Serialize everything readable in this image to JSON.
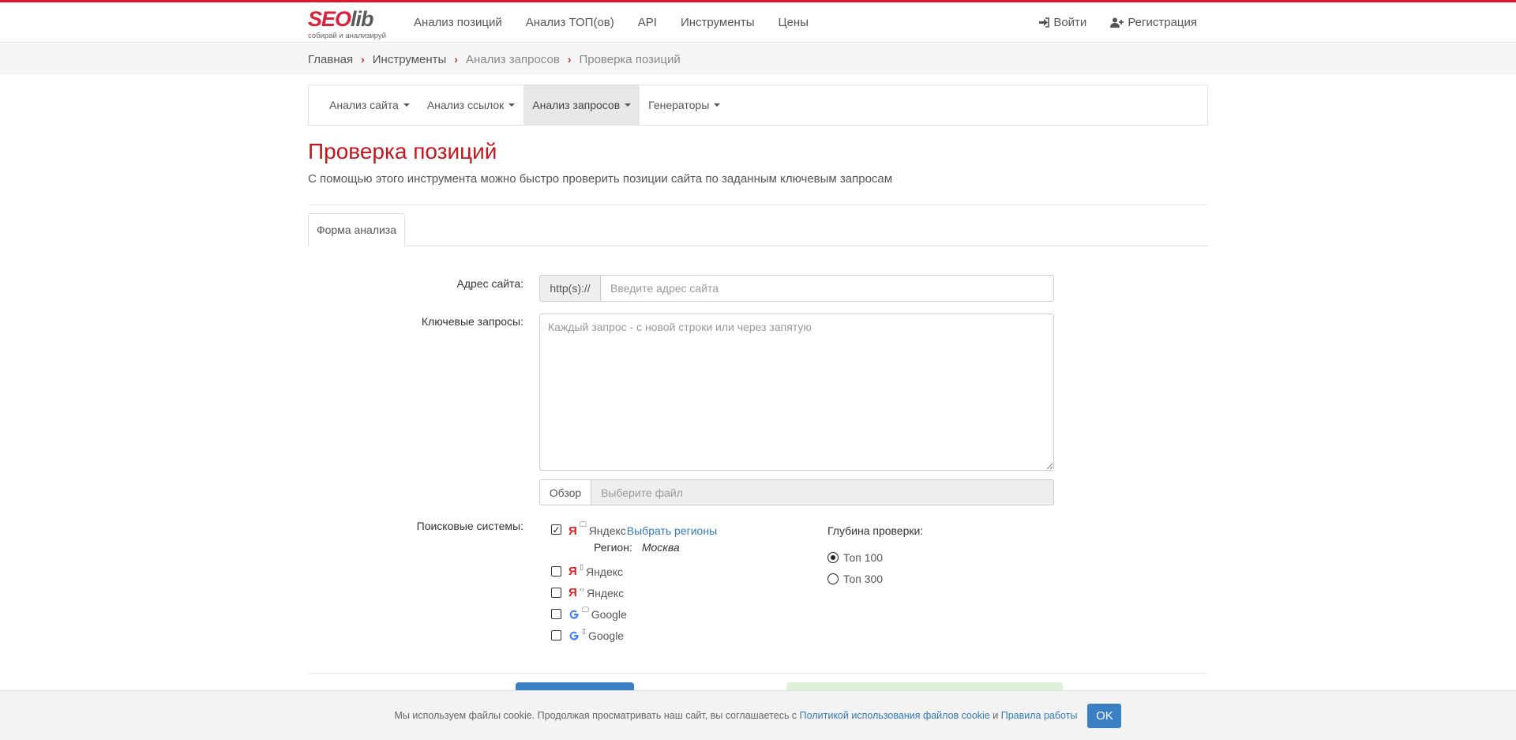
{
  "brand": {
    "logo_main_1": "SEO",
    "logo_main_2": "lib",
    "tagline": "собирай и анализируй",
    "accent_color": "#e0162b",
    "title_color": "#c4161c",
    "link_color": "#337ab7"
  },
  "nav": {
    "items": [
      {
        "label": "Анализ позиций"
      },
      {
        "label": "Анализ ТОП(ов)"
      },
      {
        "label": "API"
      },
      {
        "label": "Инструменты"
      },
      {
        "label": "Цены"
      }
    ],
    "login": {
      "label": "Войти",
      "icon": "sign-in-icon"
    },
    "register": {
      "label": "Регистрация",
      "icon": "user-plus-icon"
    }
  },
  "breadcrumb": {
    "items": [
      {
        "label": "Главная"
      },
      {
        "label": "Инструменты"
      },
      {
        "label": "Анализ запросов"
      },
      {
        "label": "Проверка позиций"
      }
    ]
  },
  "subnav": {
    "items": [
      {
        "label": "Анализ сайта"
      },
      {
        "label": "Анализ ссылок"
      },
      {
        "label": "Анализ запросов"
      },
      {
        "label": "Генераторы"
      }
    ]
  },
  "page": {
    "title": "Проверка позиций",
    "description": "С помощью этого инструмента можно быстро проверить позиции сайта по заданным ключевым запросам"
  },
  "tabs": [
    {
      "label": "Форма анализа"
    }
  ],
  "form": {
    "site_label": "Адрес сайта:",
    "site_prefix": "http(s)://",
    "site_placeholder": "Введите адрес сайта",
    "keywords_label": "Ключевые запросы:",
    "keywords_placeholder": "Каждый запрос - с новой строки или через запятую",
    "file_button": "Обзор",
    "file_placeholder": "Выберите файл",
    "engines_label": "Поисковые системы:",
    "engines": [
      {
        "name": "Яндекс",
        "logo": "Я",
        "device": "desktop-icon",
        "checked": true
      },
      {
        "name": "Яндекс",
        "logo": "Я",
        "device": "mobile-icon",
        "checked": false
      },
      {
        "name": "Яндекс",
        "logo": "Я",
        "device": "code-icon",
        "checked": false
      },
      {
        "name": "Google",
        "logo": "G",
        "device": "desktop-icon",
        "checked": false
      },
      {
        "name": "Google",
        "logo": "G",
        "device": "mobile-icon",
        "checked": false
      }
    ],
    "select_regions": "Выбрать регионы",
    "region_label": "Регион:",
    "region_value": "Москва",
    "depth_label": "Глубина проверки:",
    "depth_options": [
      {
        "label": "Топ 100",
        "checked": true
      },
      {
        "label": "Топ 300",
        "checked": false
      }
    ]
  },
  "cookie": {
    "text": "Мы используем файлы cookie. Продолжая просматривать наш сайт, вы соглашаетесь с",
    "policy_link": "Политикой использования файлов cookie",
    "and": "и",
    "rules_link": "Правила работы",
    "ok": "OK"
  }
}
